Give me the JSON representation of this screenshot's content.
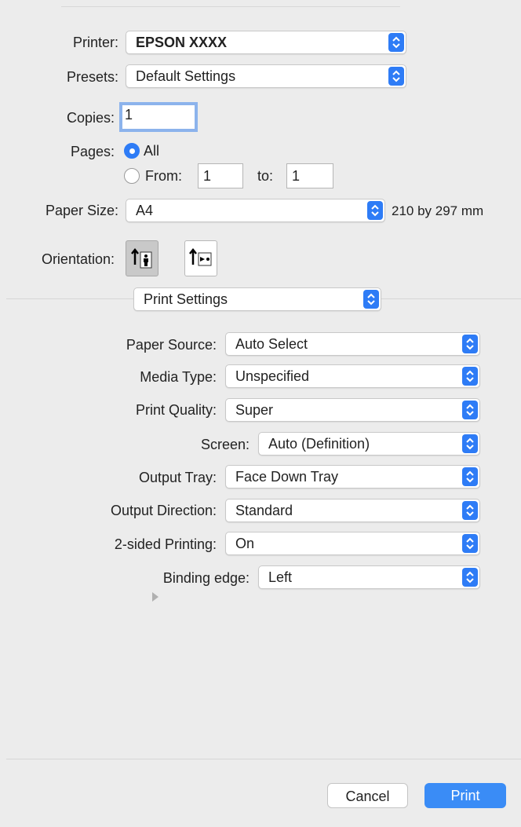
{
  "printer": {
    "label": "Printer:",
    "value": "EPSON XXXX"
  },
  "presets": {
    "label": "Presets:",
    "value": "Default Settings"
  },
  "copies": {
    "label": "Copies:",
    "value": "1"
  },
  "pages": {
    "label": "Pages:",
    "all_label": "All",
    "from_label": "From:",
    "from_value": "1",
    "to_label": "to:",
    "to_value": "1",
    "selected": "All"
  },
  "paper_size": {
    "label": "Paper Size:",
    "value": "A4",
    "dimensions": "210 by 297 mm"
  },
  "orientation": {
    "label": "Orientation:",
    "options": [
      "portrait-icon",
      "landscape-icon"
    ],
    "selected": "portrait"
  },
  "section_popup": {
    "value": "Print Settings"
  },
  "settings": [
    {
      "label": "Paper Source:",
      "value": "Auto Select"
    },
    {
      "label": "Media Type:",
      "value": "Unspecified"
    },
    {
      "label": "Print Quality:",
      "value": "Super"
    },
    {
      "label": "Screen:",
      "value": "Auto (Definition)"
    },
    {
      "label": "Output Tray:",
      "value": "Face Down Tray"
    },
    {
      "label": "Output Direction:",
      "value": "Standard"
    },
    {
      "label": "2-sided Printing:",
      "value": "On"
    },
    {
      "label": "Binding edge:",
      "value": "Left"
    }
  ],
  "buttons": {
    "cancel": "Cancel",
    "print": "Print"
  },
  "colors": {
    "accent": "#2e7cf6",
    "print_button": "#3a8cf6",
    "background": "#ececec"
  }
}
